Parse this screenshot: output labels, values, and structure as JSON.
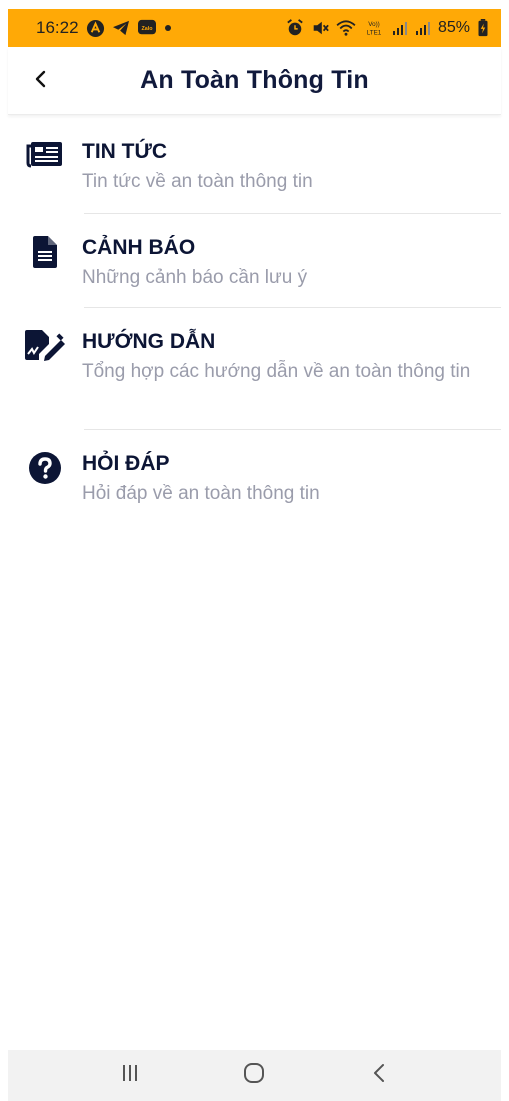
{
  "status_bar": {
    "time": "16:22",
    "battery": "85%",
    "background_color": "#FFA906",
    "left_icons": [
      "app-a-icon",
      "telegram-icon",
      "zalo-icon",
      "dot-icon"
    ],
    "right_icons": [
      "alarm-icon",
      "mute-icon",
      "wifi-icon",
      "volte-lte-icon",
      "signal-icon",
      "signal-icon",
      "battery-charging-icon"
    ],
    "zalo_label": "Zalo",
    "volte_top": "Vo))",
    "volte_bottom": "LTE1"
  },
  "header": {
    "title": "An Toàn Thông Tin",
    "back_icon": "chevron-left-icon"
  },
  "menu": {
    "items": [
      {
        "icon": "newspaper-icon",
        "title": "TIN TỨC",
        "subtitle": "Tin tức về an toàn thông tin"
      },
      {
        "icon": "document-icon",
        "title": "CẢNH BÁO",
        "subtitle": "Những cảnh báo cần lưu ý"
      },
      {
        "icon": "signature-icon",
        "title": "HƯỚNG DẪN",
        "subtitle": "Tổng hợp các hướng dẫn về an toàn thông tin"
      },
      {
        "icon": "question-circle-icon",
        "title": "HỎI ĐÁP",
        "subtitle": "Hỏi đáp về an toàn thông tin"
      }
    ]
  },
  "nav_bar": {
    "buttons": [
      "recent-apps-icon",
      "home-icon",
      "back-icon"
    ]
  },
  "colors": {
    "title": "#111a3c",
    "item_title": "#0c1535",
    "item_subtitle": "#9a9cab",
    "nav_background": "#f2f2f2"
  }
}
